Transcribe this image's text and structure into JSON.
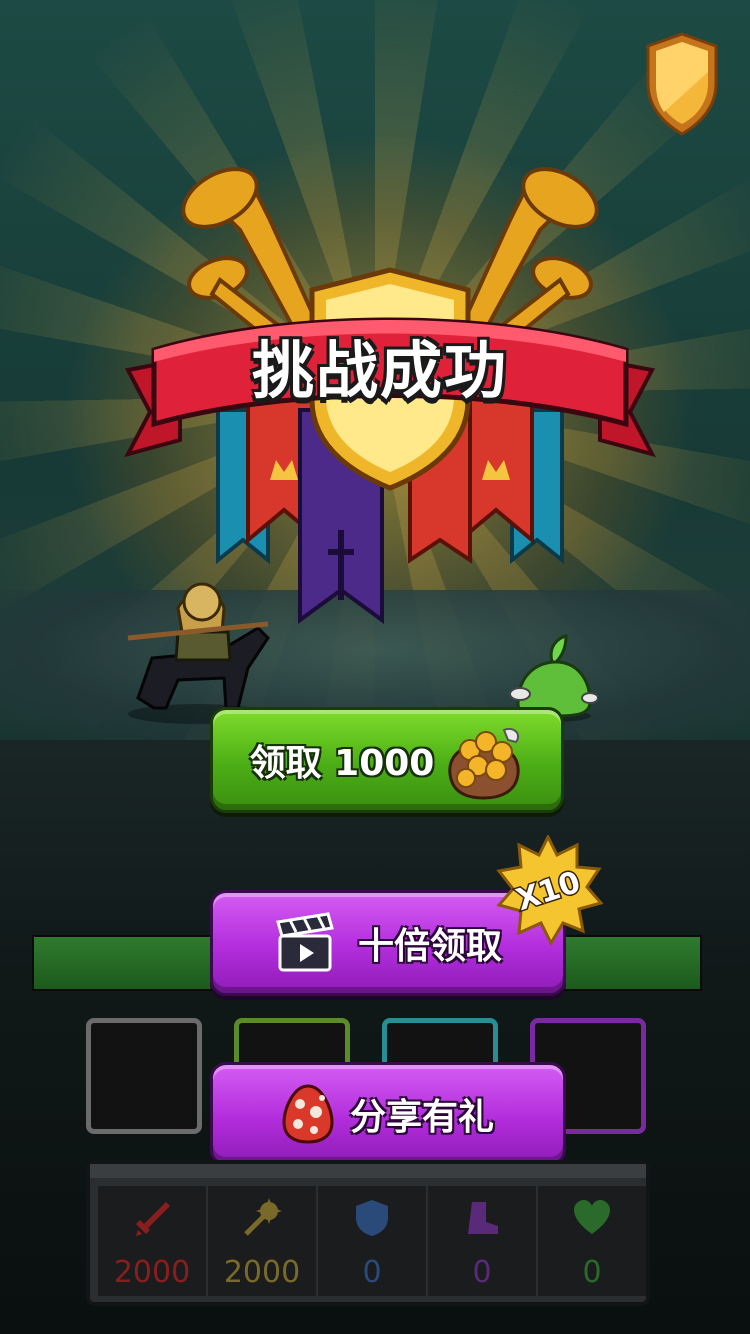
{
  "result": {
    "title": "挑战成功"
  },
  "rewards": {
    "claim_label": "领取 1000",
    "claim_x10_label": "十倍领取",
    "x10_badge": "X10",
    "share_label": "分享有礼",
    "progress": 1.0
  },
  "equipment_slots": [
    {
      "rarity": "common",
      "color": "#6b6b6b"
    },
    {
      "rarity": "uncommon",
      "color": "#5a8a2a"
    },
    {
      "rarity": "rare",
      "color": "#2b8c96"
    },
    {
      "rarity": "epic",
      "color": "#7a2aa0"
    }
  ],
  "stats": [
    {
      "icon": "sword-icon",
      "value": "2000",
      "color": "#8a1e1e"
    },
    {
      "icon": "mace-icon",
      "value": "2000",
      "color": "#7a6a2a"
    },
    {
      "icon": "shield-icon",
      "value": "0",
      "color": "#2a4a7a"
    },
    {
      "icon": "boot-icon",
      "value": "0",
      "color": "#5a2a7a"
    },
    {
      "icon": "heart-icon",
      "value": "0",
      "color": "#2a6a2a"
    }
  ],
  "colors": {
    "green_button": "#4cae16",
    "purple_button": "#b22ddc",
    "ribbon": "#e0213a",
    "gold": "#f2b430"
  }
}
